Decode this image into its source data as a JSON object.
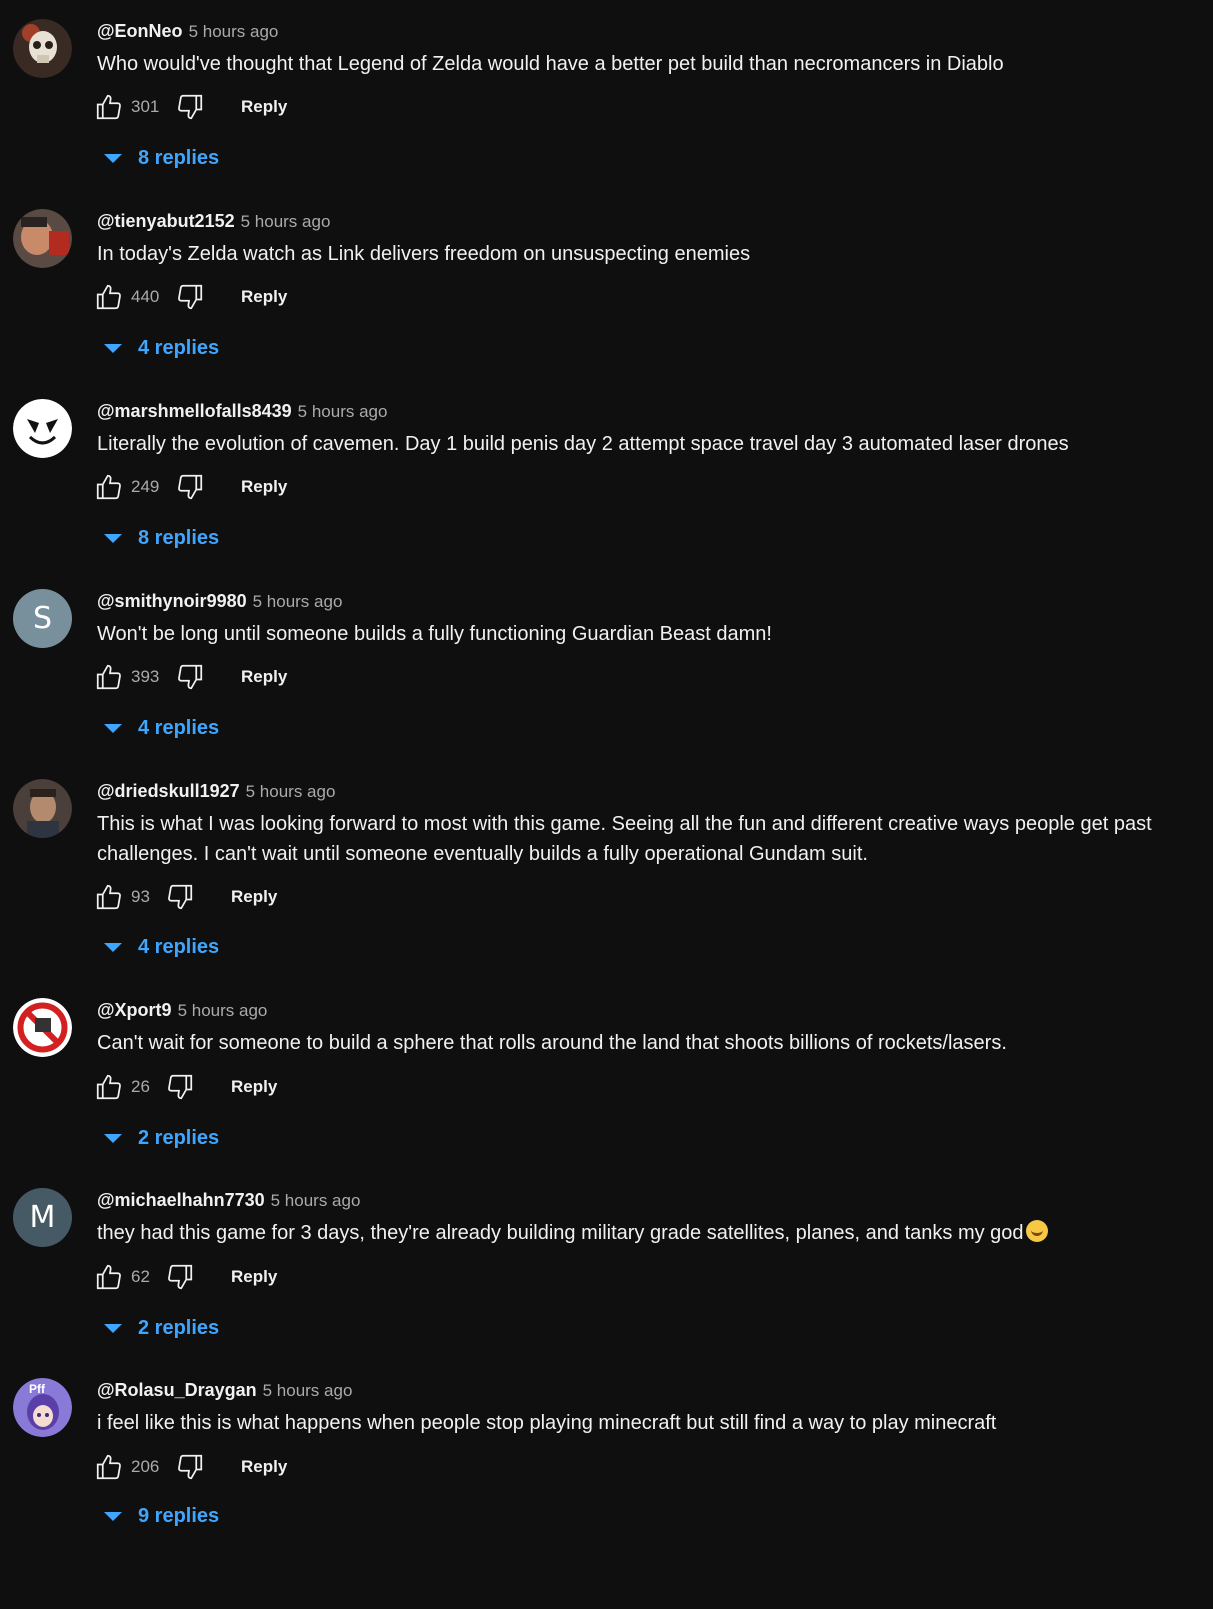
{
  "comments": [
    {
      "handle": "@EonNeo",
      "time": "5 hours ago",
      "text": "Who would've thought that Legend of Zelda would have a better pet build than necromancers in Diablo",
      "likes": "301",
      "reply": "Reply",
      "replies": "8 replies",
      "avatar": "skull-avatar",
      "avatar_color": "#3a2a24"
    },
    {
      "handle": "@tienyabut2152",
      "time": "5 hours ago",
      "text": "In today's Zelda watch as Link delivers freedom on unsuspecting enemies",
      "likes": "440",
      "reply": "Reply",
      "replies": "4 replies",
      "avatar": "photo-avatar",
      "avatar_color": "#5a4a44"
    },
    {
      "handle": "@marshmellofalls8439",
      "time": "5 hours ago",
      "text": "Literally the evolution of cavemen. Day 1 build penis day 2 attempt space travel day 3 automated laser drones",
      "likes": "249",
      "reply": "Reply",
      "replies": "8 replies",
      "avatar": "marshmello-avatar",
      "avatar_color": "#ffffff"
    },
    {
      "handle": "@smithynoir9980",
      "time": "5 hours ago",
      "text": "Won't be long until someone builds a fully functioning Guardian Beast damn!",
      "likes": "393",
      "reply": "Reply",
      "replies": "4 replies",
      "avatar": "letter-avatar",
      "avatar_letter": "S",
      "avatar_color": "#78909c"
    },
    {
      "handle": "@driedskull1927",
      "time": "5 hours ago",
      "text": "This is what I was looking forward to most with this game. Seeing all the fun and different creative ways people get past challenges. I can't wait until someone eventually builds a fully operational Gundam suit.",
      "likes": "93",
      "reply": "Reply",
      "replies": "4 replies",
      "avatar": "photo-avatar",
      "avatar_color": "#4a3f3a"
    },
    {
      "handle": "@Xport9",
      "time": "5 hours ago",
      "text": "Can't wait for someone to build a sphere that rolls around the land that shoots billions of rockets/lasers.",
      "likes": "26",
      "reply": "Reply",
      "replies": "2 replies",
      "avatar": "no-sign-avatar",
      "avatar_color": "#ffffff"
    },
    {
      "handle": "@michaelhahn7730",
      "time": "5 hours ago",
      "text": "they had this game for 3 days, they're already building military grade satellites, planes, and tanks my god",
      "likes": "62",
      "reply": "Reply",
      "replies": "2 replies",
      "avatar": "letter-avatar",
      "avatar_letter": "M",
      "avatar_color": "#455a64",
      "emoji": "joy-emoji"
    },
    {
      "handle": "@Rolasu_Draygan",
      "time": "5 hours ago",
      "text": "i feel like this is what happens when people stop playing minecraft but still find a way to play minecraft",
      "likes": "206",
      "reply": "Reply",
      "replies": "9 replies",
      "avatar": "anime-avatar",
      "avatar_color": "#8a7ad8",
      "avatar_badge": "Pff"
    }
  ]
}
